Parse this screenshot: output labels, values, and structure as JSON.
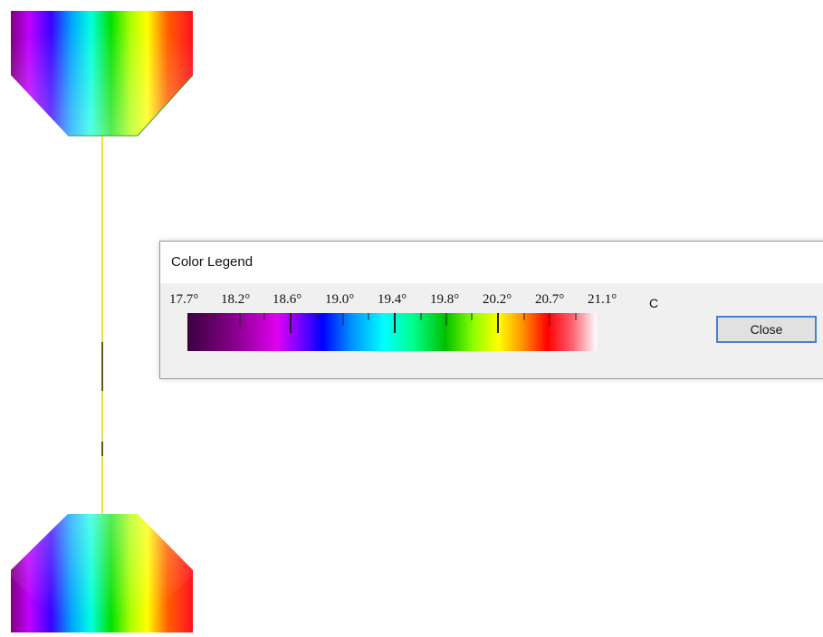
{
  "legend_dialog": {
    "title": "Color Legend",
    "tick_labels": [
      "17.7°",
      "18.2°",
      "18.6°",
      "19.0°",
      "19.4°",
      "19.8°",
      "20.2°",
      "20.7°",
      "21.1°"
    ],
    "unit": "C",
    "close_label": "Close"
  },
  "scene": {
    "connector_color": "#e8d200",
    "cone_gradient": [
      "#8a00ff",
      "#0000ff",
      "#00ffff",
      "#00ff00",
      "#ffff00",
      "#ff8000",
      "#ff0000"
    ]
  },
  "colors": {
    "dialog_background": "#f0f0f0",
    "close_button_border": "#4a7fd0"
  }
}
